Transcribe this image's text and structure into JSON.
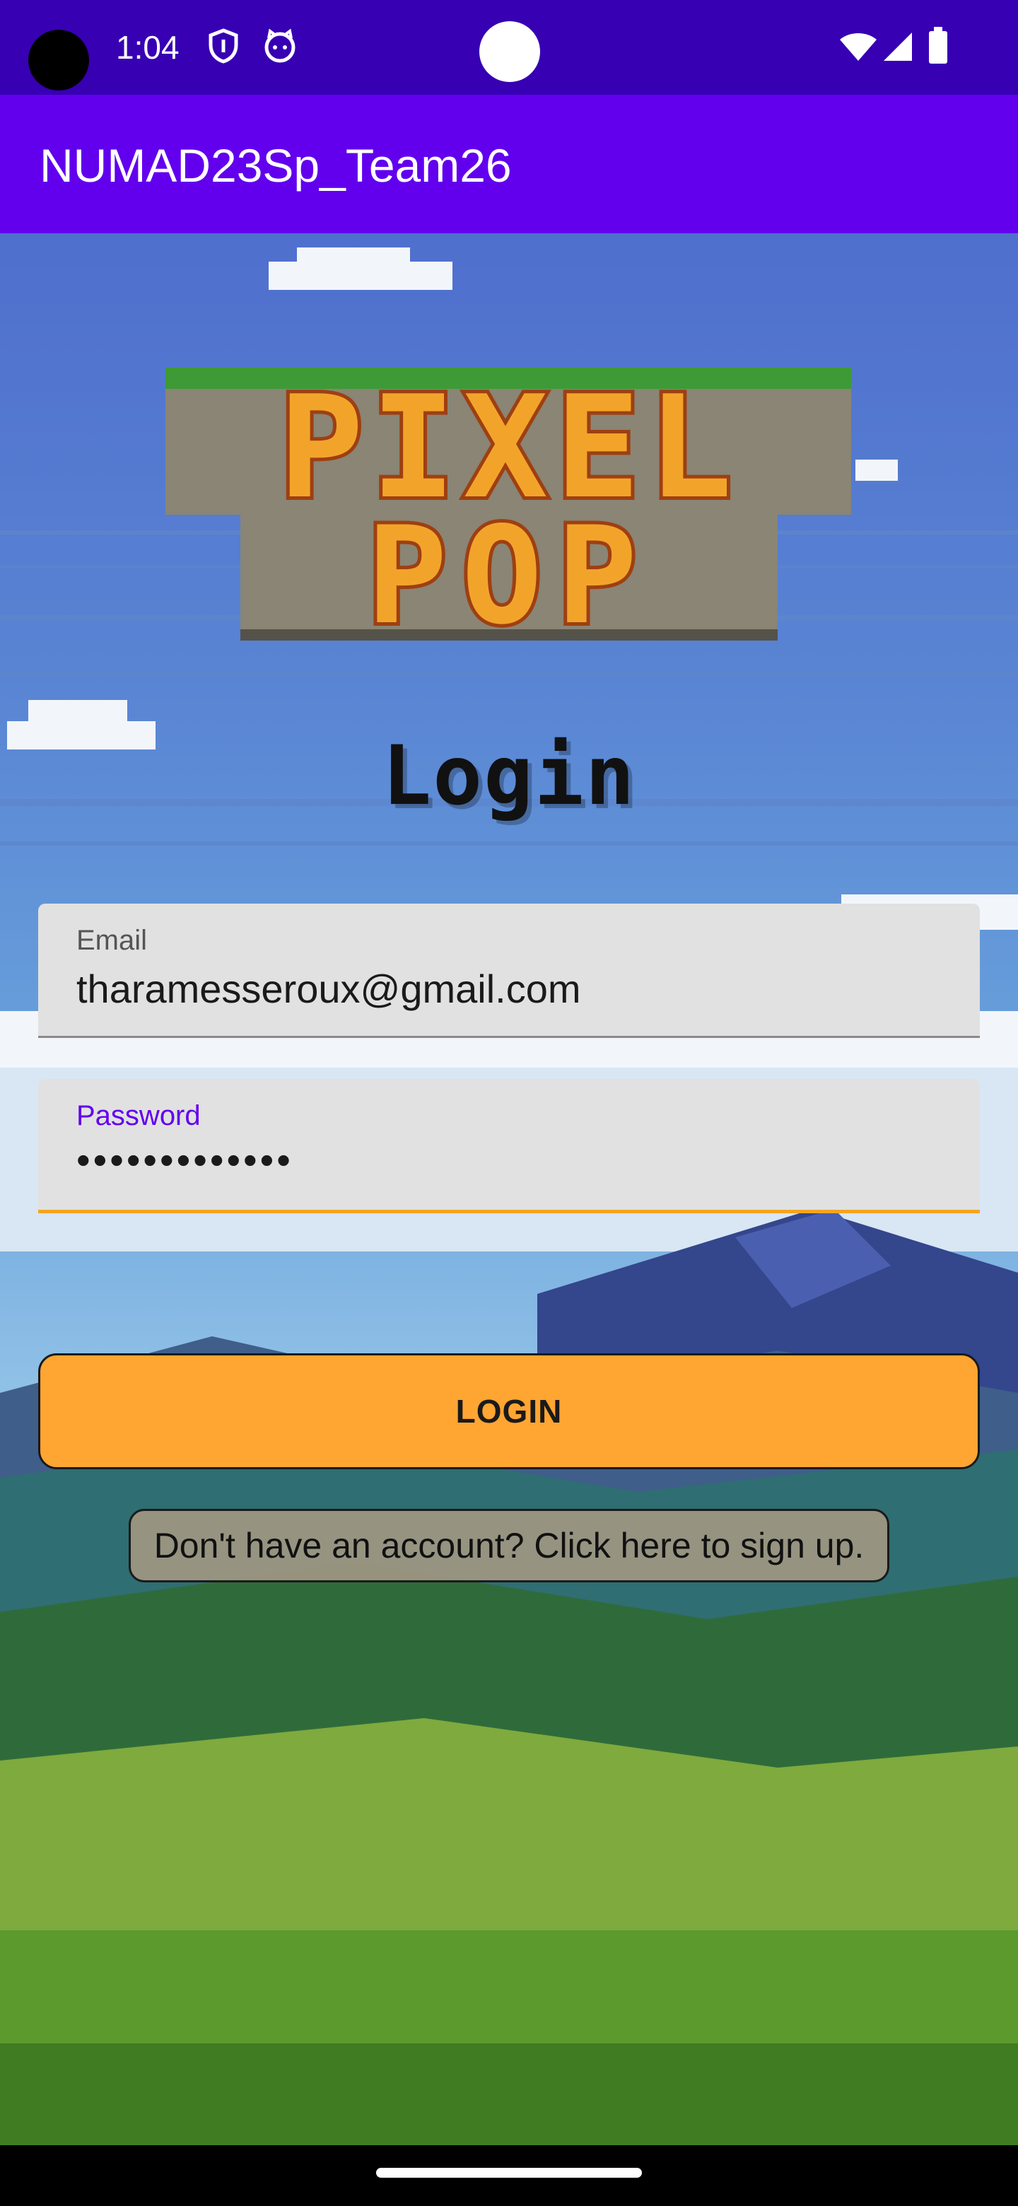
{
  "status_bar": {
    "time": "1:04",
    "left_icons": [
      "shield-icon",
      "cat-icon"
    ],
    "right_icons": [
      "wifi-icon",
      "signal-icon",
      "battery-icon"
    ]
  },
  "app_bar": {
    "title": "NUMAD23Sp_Team26",
    "color": "#6200ee"
  },
  "logo": {
    "line1": "PIXEL",
    "line2": "POP"
  },
  "screen": {
    "title": "Login"
  },
  "form": {
    "email": {
      "label": "Email",
      "value": "tharamesseroux@gmail.com"
    },
    "password": {
      "label": "Password",
      "value": "•••••••••••••"
    }
  },
  "actions": {
    "login_label": "LOGIN",
    "signup_label": "Don't have an account? Click here to sign up."
  },
  "colors": {
    "status_bar": "#3700b3",
    "app_bar": "#6200ee",
    "login_button": "#ffa532",
    "password_underline": "#f4a522"
  }
}
